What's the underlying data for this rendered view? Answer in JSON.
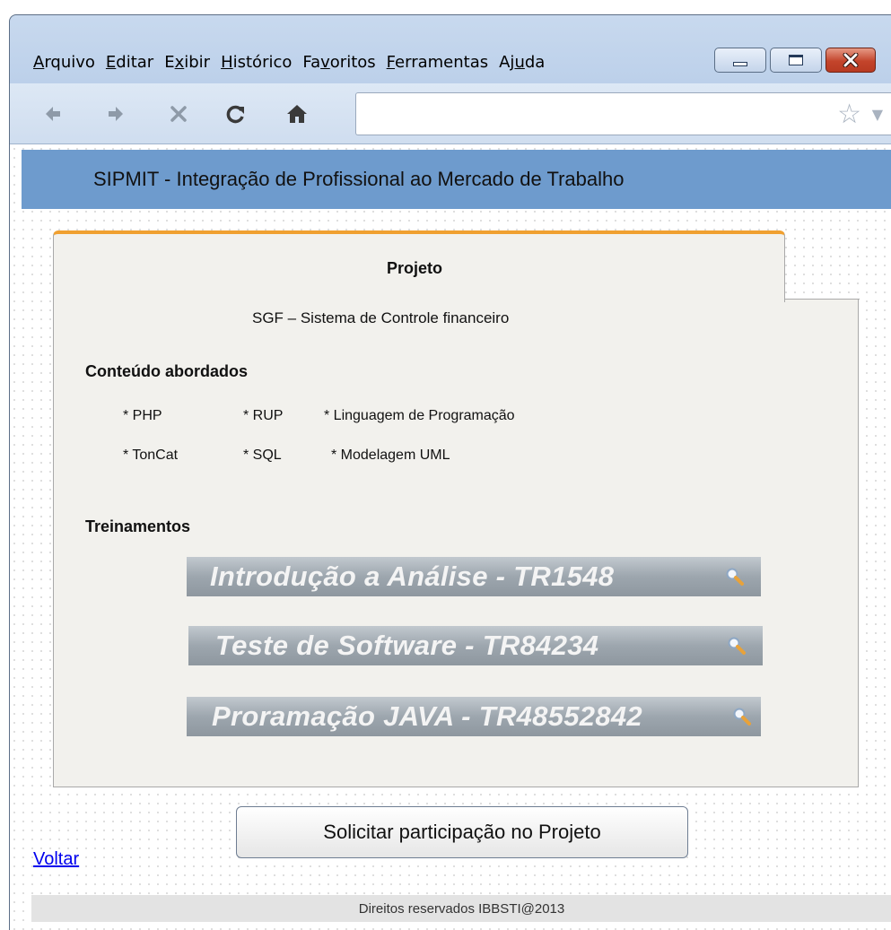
{
  "menu": {
    "items": [
      {
        "label": "Arquivo",
        "accel_index": 0
      },
      {
        "label": "Editar",
        "accel_index": 0
      },
      {
        "label": "Exibir",
        "accel_index": 1
      },
      {
        "label": "Histórico",
        "accel_index": 0
      },
      {
        "label": "Favoritos",
        "accel_index": 2
      },
      {
        "label": "Ferramentas",
        "accel_index": 0
      },
      {
        "label": "Ajuda",
        "accel_index": 2
      }
    ]
  },
  "toolbar": {
    "back_icon": "arrow-left-icon",
    "forward_icon": "arrow-right-icon",
    "stop_icon": "close-icon",
    "reload_icon": "reload-icon",
    "home_icon": "home-icon",
    "address_value": "",
    "bookmark_icon": "star-icon"
  },
  "app": {
    "title": "SIPMIT - Integração de Profissional ao Mercado de Trabalho"
  },
  "project": {
    "label": "Projeto",
    "name": "SGF – Sistema de Controle financeiro",
    "topics_title": "Conteúdo abordados",
    "topics_row1": [
      "* PHP",
      "* RUP",
      "* Linguagem de Programação"
    ],
    "topics_row2": [
      "* TonCat",
      "* SQL",
      "* Modelagem UML"
    ],
    "trainings_title": "Treinamentos",
    "trainings": [
      "Introdução a Análise - TR1548",
      "Teste de Software - TR84234",
      "Proramação JAVA - TR48552842"
    ]
  },
  "actions": {
    "solicit_label": "Solicitar participação no Projeto",
    "back_link": "Voltar"
  },
  "footer": {
    "text": "Direitos reservados IBBSTI@2013"
  },
  "colors": {
    "header_bg": "#6e9bcd",
    "card_accent": "#f0a030",
    "link": "#0000ee",
    "close_button": "#c3442b"
  }
}
